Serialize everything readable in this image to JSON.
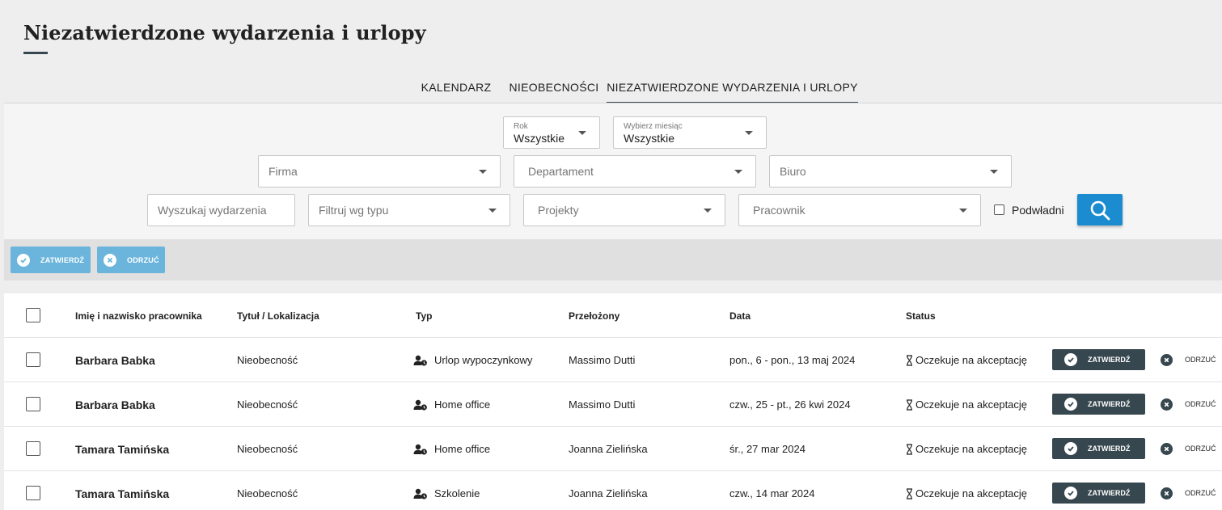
{
  "page": {
    "title": "Niezatwierdzone wydarzenia i urlopy"
  },
  "tabs": [
    {
      "label": "KALENDARZ"
    },
    {
      "label": "NIEOBECNOŚCI"
    },
    {
      "label": "NIEZATWIERDZONE WYDARZENIA I URLOPY",
      "active": true
    }
  ],
  "filters": {
    "rok": {
      "label": "Rok",
      "value": "Wszystkie"
    },
    "miesiac": {
      "label": "Wybierz miesiąc",
      "value": "Wszystkie"
    },
    "firma": {
      "placeholder": "Firma"
    },
    "departament": {
      "placeholder": "Departament"
    },
    "biuro": {
      "placeholder": "Biuro"
    },
    "search": {
      "placeholder": "Wyszukaj wydarzenia"
    },
    "typ": {
      "placeholder": "Filtruj wg typu"
    },
    "projekty": {
      "placeholder": "Projekty"
    },
    "pracownik": {
      "placeholder": "Pracownik"
    },
    "podwladni": {
      "label": "Podwładni",
      "checked": false
    }
  },
  "bulk_actions": {
    "approve": "ZATWIERDŹ",
    "reject": "ODRZUĆ"
  },
  "table": {
    "headers": {
      "name": "Imię i nazwisko pracownika",
      "title": "Tytuł / Lokalizacja",
      "type": "Typ",
      "supervisor": "Przełożony",
      "date": "Data",
      "status": "Status"
    },
    "rows": [
      {
        "name": "Barbara Babka",
        "title": "Nieobecność",
        "type": "Urlop wypoczynkowy",
        "supervisor": "Massimo Dutti",
        "date": "pon., 6 - pon., 13 maj 2024",
        "status": "Oczekuje na akceptację",
        "approve": "ZATWIERDŹ",
        "reject": "ODRZUĆ"
      },
      {
        "name": "Barbara Babka",
        "title": "Nieobecność",
        "type": "Home office",
        "supervisor": "Massimo Dutti",
        "date": "czw., 25 - pt., 26 kwi 2024",
        "status": "Oczekuje na akceptację",
        "approve": "ZATWIERDŹ",
        "reject": "ODRZUĆ"
      },
      {
        "name": "Tamara Tamińska",
        "title": "Nieobecność",
        "type": "Home office",
        "supervisor": "Joanna Zielińska",
        "date": "śr., 27 mar 2024",
        "status": "Oczekuje na akceptację",
        "approve": "ZATWIERDŹ",
        "reject": "ODRZUĆ"
      },
      {
        "name": "Tamara Tamińska",
        "title": "Nieobecność",
        "type": "Szkolenie",
        "supervisor": "Joanna Zielińska",
        "date": "czw., 14 mar 2024",
        "status": "Oczekuje na akceptację",
        "approve": "ZATWIERDŹ",
        "reject": "ODRZUĆ"
      }
    ]
  },
  "colors": {
    "accent": "#1a8ccf",
    "dark": "#37474f",
    "bulk_button": "#6bb5dc"
  }
}
